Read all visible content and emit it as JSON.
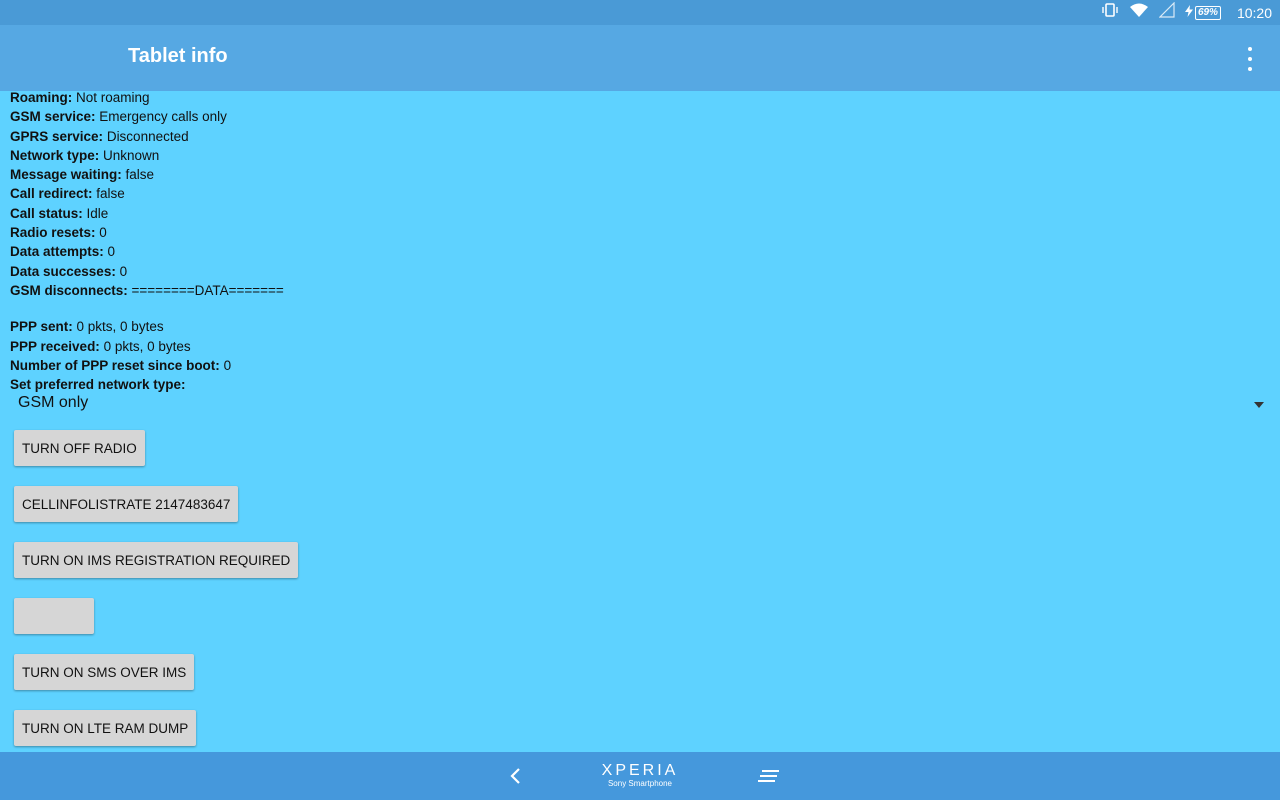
{
  "status_bar": {
    "time": "10:20",
    "battery_percent": "69%",
    "icons": [
      "vibrate-icon",
      "wifi-icon",
      "signal-icon",
      "charging-icon",
      "battery-icon"
    ]
  },
  "app_bar": {
    "title": "Tablet info",
    "menu_icon": "overflow-menu-icon"
  },
  "info": [
    {
      "label": "Roaming:",
      "value": " Not roaming"
    },
    {
      "label": "GSM service:",
      "value": " Emergency calls only"
    },
    {
      "label": "GPRS service:",
      "value": " Disconnected"
    },
    {
      "label": "Network type:",
      "value": " Unknown"
    },
    {
      "label": "Message waiting:",
      "value": " false"
    },
    {
      "label": "Call redirect:",
      "value": " false"
    },
    {
      "label": "Call status:",
      "value": " Idle"
    },
    {
      "label": "Radio resets:",
      "value": " 0"
    },
    {
      "label": "Data attempts:",
      "value": " 0"
    },
    {
      "label": "Data successes:",
      "value": " 0"
    },
    {
      "label": "GSM disconnects:",
      "value": " ========DATA======="
    }
  ],
  "ppp": [
    {
      "label": "PPP sent:",
      "value": " 0 pkts, 0 bytes"
    },
    {
      "label": "PPP received:",
      "value": " 0 pkts, 0 bytes"
    },
    {
      "label": "Number of PPP reset since boot:",
      "value": " 0"
    },
    {
      "label": "Set preferred network type:",
      "value": ""
    }
  ],
  "network_type_selector": {
    "selected": "GSM only"
  },
  "buttons": [
    {
      "label": "TURN OFF RADIO"
    },
    {
      "label": "CELLINFOLISTRATE 2147483647"
    },
    {
      "label": "TURN ON IMS REGISTRATION REQUIRED"
    },
    {
      "label": ""
    },
    {
      "label": "TURN ON SMS OVER IMS"
    },
    {
      "label": "TURN ON LTE RAM DUMP"
    }
  ],
  "nav_bar": {
    "brand": "XPERIA",
    "brand_sub": "Sony Smartphone",
    "icons": [
      "back-icon",
      "recent-apps-icon"
    ]
  }
}
